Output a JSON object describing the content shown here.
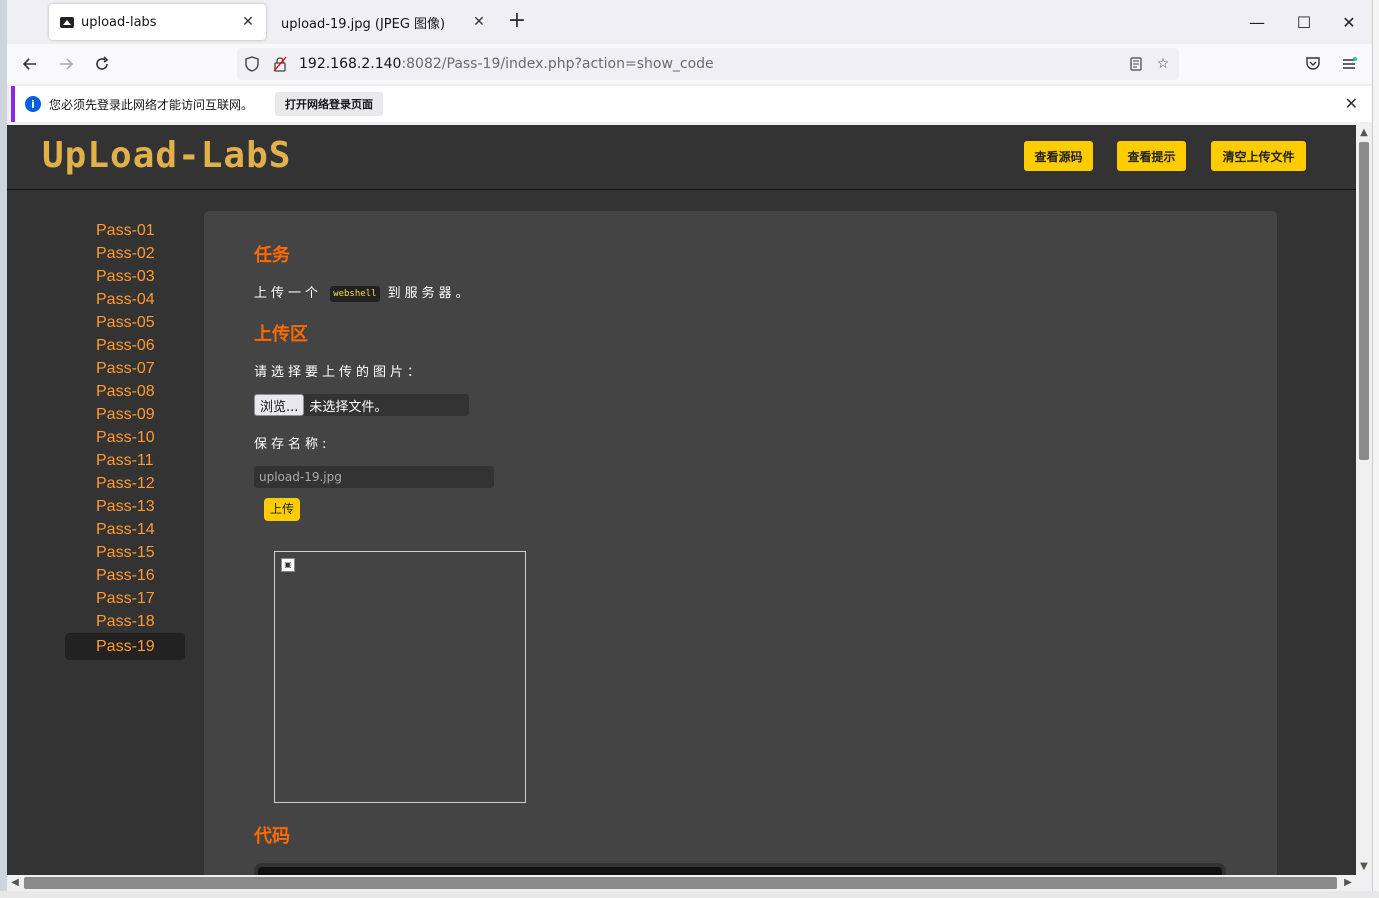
{
  "tabs": [
    {
      "title": "upload-labs",
      "active": true
    },
    {
      "title": "upload-19.jpg (JPEG 图像)",
      "active": false
    }
  ],
  "window_controls": {
    "minimize": "—",
    "maximize": "☐",
    "close": "✕"
  },
  "nav": {
    "url_host": "192.168.2.140",
    "url_rest": ":8082/Pass-19/index.php?action=show_code"
  },
  "notice": {
    "text": "您必须先登录此网络才能访问互联网。",
    "button": "打开网络登录页面"
  },
  "header": {
    "logo": "UpLoad-LabS",
    "buttons": [
      "查看源码",
      "查看提示",
      "清空上传文件"
    ]
  },
  "sidebar": {
    "items": [
      "Pass-01",
      "Pass-02",
      "Pass-03",
      "Pass-04",
      "Pass-05",
      "Pass-06",
      "Pass-07",
      "Pass-08",
      "Pass-09",
      "Pass-10",
      "Pass-11",
      "Pass-12",
      "Pass-13",
      "Pass-14",
      "Pass-15",
      "Pass-16",
      "Pass-17",
      "Pass-18",
      "Pass-19"
    ],
    "active": "Pass-19"
  },
  "content": {
    "task_title": "任务",
    "task_pre": "上传一个",
    "task_code": "webshell",
    "task_post": "到服务器。",
    "upload_title": "上传区",
    "choose_label": "请选择要上传的图片：",
    "browse_button": "浏览...",
    "no_file": "未选择文件。",
    "save_name_label": "保存名称:",
    "save_name_value": "upload-19.jpg",
    "upload_button": "上传",
    "code_title": "代码"
  },
  "colors": {
    "accent": "#ff6a00",
    "sidebar_link": "#ff9a32",
    "button": "#ffcc00",
    "page_bg": "#333333",
    "panel_bg": "#444444"
  }
}
